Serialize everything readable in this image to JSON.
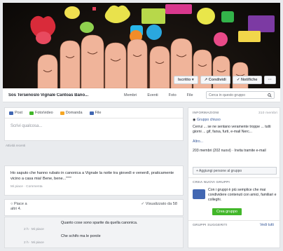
{
  "cover": {
    "buttons": [
      {
        "label": "Iscritto ▾"
      },
      {
        "label": "↗ Condividi"
      },
      {
        "label": "✓ Notifiche"
      },
      {
        "label": "···"
      }
    ]
  },
  "nav": {
    "group_name": "Sos Tersenoslo Vignale Cantoas Bano...",
    "items": [
      "Membri",
      "Eventi",
      "Foto",
      "File"
    ],
    "search_placeholder": "Cerca in questo gruppo"
  },
  "composer": {
    "tabs": [
      {
        "label": "Post",
        "color": "#4267b2"
      },
      {
        "label": "Foto/video",
        "color": "#42b72a"
      },
      {
        "label": "Domanda",
        "color": "#f5a623"
      },
      {
        "label": "File",
        "color": "#4267b2"
      }
    ],
    "placeholder": "Scrivi qualcosa..."
  },
  "feed": {
    "recent_label": "Attività recenti",
    "post_text": "Ho saputo che hanno rubato in canonica a Vignale la notte tra giovedì e venerdì, praticamente vicino a casa mia! Bene, bene...\"\"\"\"",
    "post_meta": "Mi piace · Commenta",
    "like_label": "Piace a",
    "seen_label": "✓ Visualizzato da 58",
    "like_count": "altri 4.",
    "comments": [
      {
        "text": "Quanto cose sono sparite da quella canonica.",
        "meta": "2 h · Mi piace"
      },
      {
        "text": "Che schifo ma le porole",
        "meta": "2 h · Mi piace"
      }
    ],
    "last_meta": "2 h · Mi piace"
  },
  "sidebar": {
    "info_head": "INFORMAZIONI",
    "info_count": "310 membri",
    "group_type": "Gruppo chiuso",
    "description": "Cerrui ... se ne sentano veramente troppe ... tutti giorni ... gif, farsa, furti, e-mail Nerc...",
    "more": "Altro...",
    "members_line": "203 membri (202 nuovi) · Invita tramite e-mail",
    "add_button": "+ Aggiungi persone al gruppo",
    "create_head": "CREA NUOVI GRUPPI",
    "create_text": "Con i gruppi è più semplice che mai condividere contenuti con amici, familiari e colleghi.",
    "create_button": "Crea gruppo",
    "suggested_head": "GRUPPI SUGGERITI",
    "see_all": "Vedi tutti"
  },
  "colors": {
    "accent": "#4267b2",
    "green": "#42b72a"
  }
}
